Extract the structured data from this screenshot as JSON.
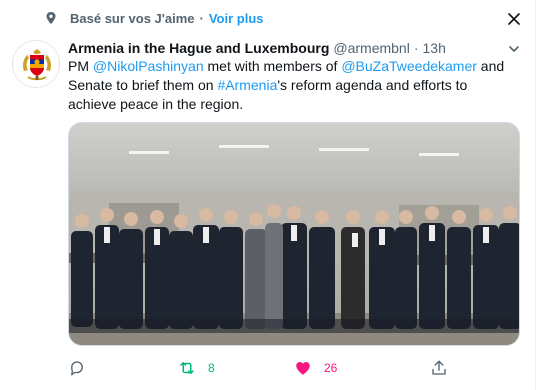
{
  "context": {
    "label": "Basé sur vos J'aime",
    "separator": "·",
    "see_more": "Voir plus"
  },
  "tweet": {
    "author_name": "Armenia in the Hague and Luxembourg",
    "handle": "@armembnl",
    "separator": "·",
    "time": "13h",
    "text_parts": [
      {
        "t": "PM ",
        "link": false
      },
      {
        "t": "@NikolPashinyan",
        "link": true
      },
      {
        "t": " met with members of ",
        "link": false
      },
      {
        "t": "@BuZaTweedekamer",
        "link": true
      },
      {
        "t": " and Senate to brief them on ",
        "link": false
      },
      {
        "t": "#Armenia",
        "link": true
      },
      {
        "t": "'s reform agenda and efforts to achieve peace in the region.",
        "link": false
      }
    ]
  },
  "actions": {
    "reply_icon": "reply-icon",
    "retweet_count": "8",
    "retweet_icon": "retweet-icon",
    "like_count": "26",
    "like_icon": "heart-icon",
    "share_icon": "share-icon"
  },
  "colors": {
    "accent": "#1d9bf0",
    "retweet": "#00ba7c",
    "like": "#f91880",
    "muted": "#536471"
  }
}
